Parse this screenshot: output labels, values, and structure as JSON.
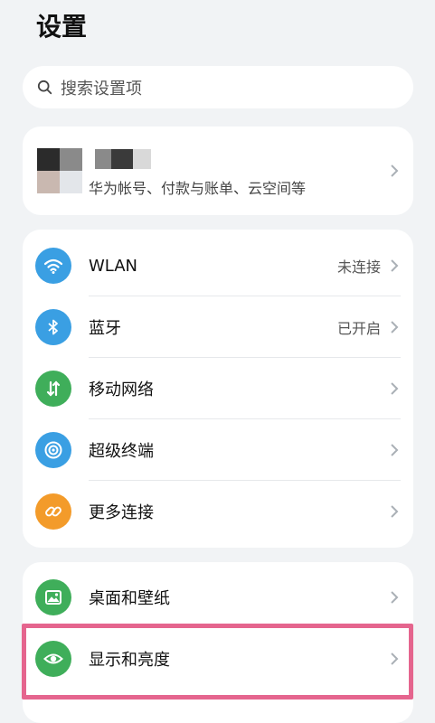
{
  "header": {
    "title": "设置"
  },
  "search": {
    "placeholder": "搜索设置项",
    "icon": "search-icon"
  },
  "account": {
    "subtitle": "华为帐号、付款与账单、云空间等",
    "icon": "avatar"
  },
  "connectivity": {
    "items": [
      {
        "label": "WLAN",
        "value": "未连接",
        "icon": "wifi-icon",
        "color": "#3a9fe3"
      },
      {
        "label": "蓝牙",
        "value": "已开启",
        "icon": "bluetooth-icon",
        "color": "#3a9fe3"
      },
      {
        "label": "移动网络",
        "value": "",
        "icon": "mobile-data-icon",
        "color": "#3fae5a"
      },
      {
        "label": "超级终端",
        "value": "",
        "icon": "super-device-icon",
        "color": "#3a9fe3"
      },
      {
        "label": "更多连接",
        "value": "",
        "icon": "link-icon",
        "color": "#f39b2a"
      }
    ]
  },
  "display": {
    "items": [
      {
        "label": "桌面和壁纸",
        "icon": "wallpaper-icon",
        "color": "#3fae5a"
      },
      {
        "label": "显示和亮度",
        "icon": "eye-icon",
        "color": "#3fae5a"
      }
    ]
  },
  "colors": {
    "highlight": "#e5658e",
    "background": "#f1f3f5"
  }
}
